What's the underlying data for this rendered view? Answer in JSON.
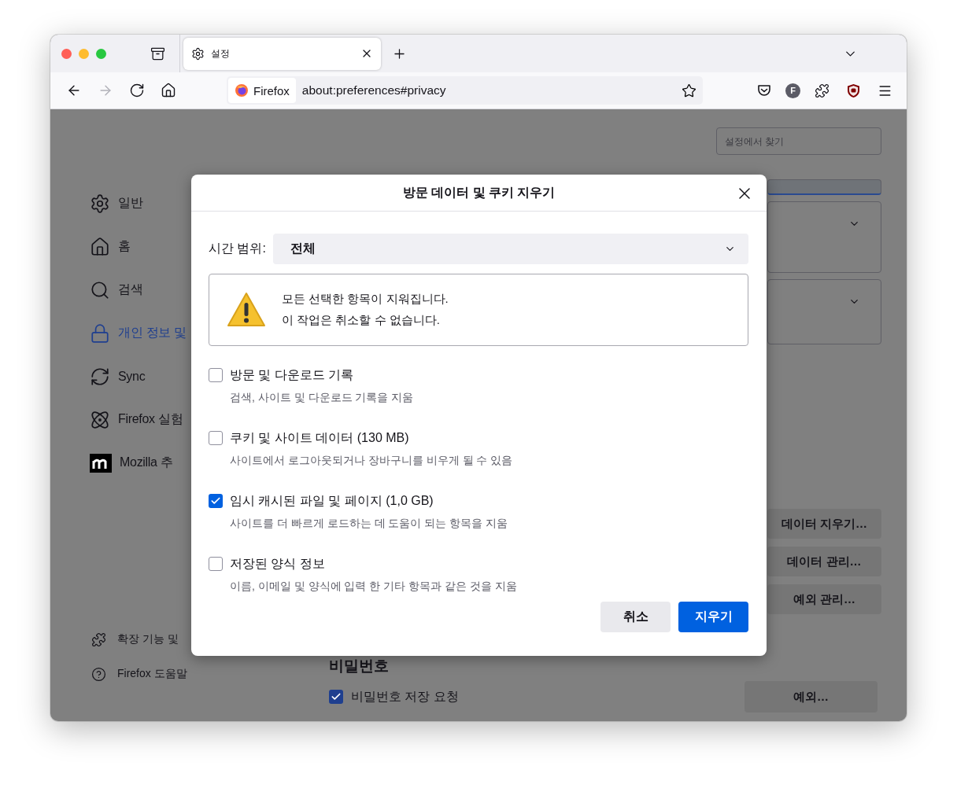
{
  "tabs": [
    {
      "label": "설정",
      "selected": true
    }
  ],
  "nav_buttons": [
    {
      "kind": "back",
      "disabled": false
    },
    {
      "kind": "forward",
      "disabled": true
    },
    {
      "kind": "reload",
      "disabled": false
    },
    {
      "kind": "home",
      "disabled": false
    }
  ],
  "address_bar": {
    "identity": "Firefox",
    "url": "about:preferences#privacy"
  },
  "toolbar_right": [
    {
      "kind": "pocket"
    },
    {
      "kind": "account",
      "text": "F"
    },
    {
      "kind": "extensions"
    },
    {
      "kind": "shield"
    },
    {
      "kind": "menu"
    }
  ],
  "search": {
    "placeholder": "설정에서 찾기"
  },
  "sidebar": {
    "items": [
      {
        "kind": "gear",
        "label": "일반",
        "selected": false
      },
      {
        "kind": "home",
        "label": "홈",
        "selected": false
      },
      {
        "kind": "search",
        "label": "검색",
        "selected": false
      },
      {
        "kind": "lock",
        "label": "개인 정보 및",
        "selected": true
      },
      {
        "kind": "sync",
        "label": "Sync",
        "selected": false
      },
      {
        "kind": "atom",
        "label": "Firefox 실험",
        "selected": false
      },
      {
        "kind": "logo",
        "label": "Mozilla 추",
        "selected": false
      }
    ],
    "footer": [
      {
        "kind": "puzzle",
        "label": "확장 기능 및"
      },
      {
        "kind": "help",
        "label": "Firefox 도움말"
      }
    ]
  },
  "page_buttons": [
    "데이터 지우기…",
    "데이터 관리…",
    "예외 관리…"
  ],
  "passwords": {
    "heading": "비밀번호",
    "checkbox": {
      "label": "비밀번호 저장 요청",
      "checked": true
    },
    "button": "예외…"
  },
  "dialog": {
    "title": "방문 데이터 및 쿠키 지우기",
    "time_range": {
      "label": "시간 범위:",
      "value": "전체"
    },
    "warning": [
      "모든 선택한 항목이 지워집니다.",
      "이 작업은 취소할 수 없습니다."
    ],
    "options": [
      {
        "label": "방문 및 다운로드 기록",
        "description": "검색, 사이트 및 다운로드 기록을 지움",
        "checked": false
      },
      {
        "label": "쿠키 및 사이트 데이터 (130 MB)",
        "description": "사이트에서 로그아웃되거나 장바구니를 비우게 될 수 있음",
        "checked": false
      },
      {
        "label": "임시 캐시된 파일 및 페이지 (1,0 GB)",
        "description": "사이트를 더 빠르게 로드하는 데 도움이 되는 항목을 지움",
        "checked": true
      },
      {
        "label": "저장된 양식 정보",
        "description": "이름, 이메일 및 양식에 입력 한 기타 항목과 같은 것을 지움",
        "checked": false
      }
    ],
    "buttons": [
      {
        "label": "취소",
        "kind": "secondary"
      },
      {
        "label": "지우기",
        "kind": "primary"
      }
    ]
  }
}
